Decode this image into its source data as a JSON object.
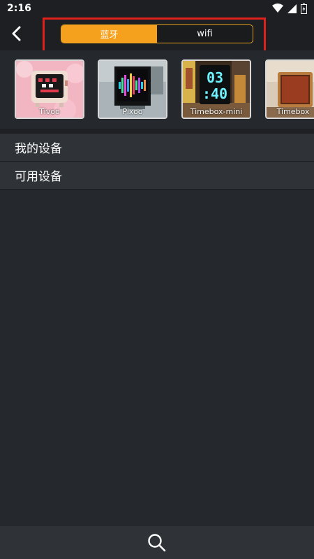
{
  "status_bar": {
    "time": "2:16",
    "icons": [
      "wifi-icon",
      "signal-icon",
      "battery-icon"
    ]
  },
  "header": {
    "back_icon": "chevron-left-icon",
    "tabs": [
      {
        "label": "蓝牙",
        "active": true
      },
      {
        "label": "wifi",
        "active": false
      }
    ]
  },
  "devices": [
    {
      "label": "Tivoo"
    },
    {
      "label": "Pixoo"
    },
    {
      "label": "Timebox-mini",
      "screen_text": [
        "03",
        ":40"
      ]
    },
    {
      "label": "Timebox"
    }
  ],
  "sections": [
    {
      "label": "我的设备"
    },
    {
      "label": "可用设备"
    }
  ],
  "footer": {
    "search_icon": "search-icon"
  },
  "colors": {
    "accent": "#f5a11e",
    "highlight": "#e0211b",
    "background": "#25282c",
    "row": "#2f3338"
  }
}
